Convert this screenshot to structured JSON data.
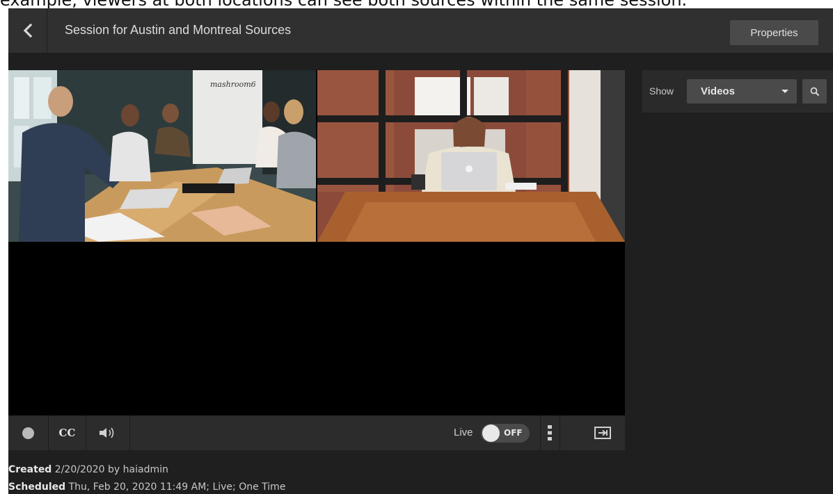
{
  "caption_text": "example, viewers at both locations can see both sources within the same session.",
  "header": {
    "back_icon": "chevron-left-icon",
    "title": "Session for Austin and Montreal Sources",
    "properties_label": "Properties"
  },
  "video": {
    "tile_a_sign": "mashroom6"
  },
  "controls": {
    "record_icon": "record-dot-icon",
    "cc_label": "CC",
    "volume_icon": "speaker-icon",
    "live_label": "Live",
    "toggle_state": "OFF",
    "more_icon": "vertical-dots-icon",
    "exit_icon": "exit-fullscreen-icon"
  },
  "info": {
    "created_label": "Created",
    "created_value": "2/20/2020 by haiadmin",
    "scheduled_label": "Scheduled",
    "scheduled_value": "Thu, Feb 20, 2020 11:49 AM; Live; One Time"
  },
  "side": {
    "show_label": "Show",
    "select_value": "Videos",
    "search_icon": "search-icon"
  },
  "colors": {
    "app_bg": "#1f1f1f",
    "header_bg": "#303030",
    "button_bg": "#4a4a4a",
    "controls_bg": "#2c2c2c"
  }
}
